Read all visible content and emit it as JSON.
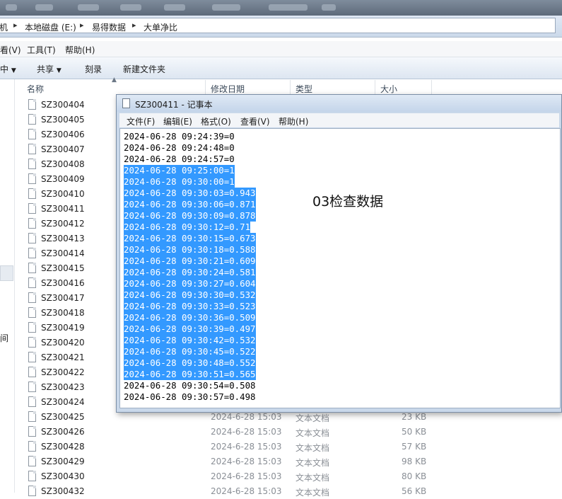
{
  "explorer": {
    "breadcrumb": [
      "机",
      "本地磁盘 (E:)",
      "易得数据",
      "大单净比"
    ],
    "menu": [
      "看(V)",
      "工具(T)",
      "帮助(H)"
    ],
    "toolbar": [
      "中",
      "共享",
      "刻录",
      "新建文件夹"
    ],
    "columns": {
      "name": "名称",
      "date": "修改日期",
      "type": "类型",
      "size": "大小"
    },
    "left_pane_label": "间",
    "files": [
      {
        "name": "SZ300404",
        "date": "",
        "type": "",
        "size": ""
      },
      {
        "name": "SZ300405",
        "date": "",
        "type": "",
        "size": ""
      },
      {
        "name": "SZ300406",
        "date": "",
        "type": "",
        "size": ""
      },
      {
        "name": "SZ300407",
        "date": "",
        "type": "",
        "size": ""
      },
      {
        "name": "SZ300408",
        "date": "",
        "type": "",
        "size": ""
      },
      {
        "name": "SZ300409",
        "date": "",
        "type": "",
        "size": ""
      },
      {
        "name": "SZ300410",
        "date": "",
        "type": "",
        "size": ""
      },
      {
        "name": "SZ300411",
        "date": "",
        "type": "",
        "size": ""
      },
      {
        "name": "SZ300412",
        "date": "",
        "type": "",
        "size": ""
      },
      {
        "name": "SZ300413",
        "date": "",
        "type": "",
        "size": ""
      },
      {
        "name": "SZ300414",
        "date": "",
        "type": "",
        "size": ""
      },
      {
        "name": "SZ300415",
        "date": "",
        "type": "",
        "size": ""
      },
      {
        "name": "SZ300416",
        "date": "",
        "type": "",
        "size": ""
      },
      {
        "name": "SZ300417",
        "date": "",
        "type": "",
        "size": ""
      },
      {
        "name": "SZ300418",
        "date": "",
        "type": "",
        "size": ""
      },
      {
        "name": "SZ300419",
        "date": "",
        "type": "",
        "size": ""
      },
      {
        "name": "SZ300420",
        "date": "",
        "type": "",
        "size": ""
      },
      {
        "name": "SZ300421",
        "date": "",
        "type": "",
        "size": ""
      },
      {
        "name": "SZ300422",
        "date": "",
        "type": "",
        "size": ""
      },
      {
        "name": "SZ300423",
        "date": "",
        "type": "",
        "size": ""
      },
      {
        "name": "SZ300424",
        "date": "",
        "type": "",
        "size": ""
      },
      {
        "name": "SZ300425",
        "date": "2024-6-28 15:03",
        "type": "文本文档",
        "size": "23 KB"
      },
      {
        "name": "SZ300426",
        "date": "2024-6-28 15:03",
        "type": "文本文档",
        "size": "50 KB"
      },
      {
        "name": "SZ300428",
        "date": "2024-6-28 15:03",
        "type": "文本文档",
        "size": "57 KB"
      },
      {
        "name": "SZ300429",
        "date": "2024-6-28 15:03",
        "type": "文本文档",
        "size": "98 KB"
      },
      {
        "name": "SZ300430",
        "date": "2024-6-28 15:03",
        "type": "文本文档",
        "size": "80 KB"
      },
      {
        "name": "SZ300432",
        "date": "2024-6-28 15:03",
        "type": "文本文档",
        "size": "56 KB"
      }
    ]
  },
  "notepad": {
    "title": "SZ300411 - 记事本",
    "menu": [
      "文件(F)",
      "编辑(E)",
      "格式(O)",
      "查看(V)",
      "帮助(H)"
    ],
    "lines": [
      {
        "text": "2024-06-28 09:24:39=0",
        "selected": false
      },
      {
        "text": "2024-06-28 09:24:48=0",
        "selected": false
      },
      {
        "text": "2024-06-28 09:24:57=0",
        "selected": false
      },
      {
        "text": "2024-06-28 09:25:00=1",
        "selected": true
      },
      {
        "text": "2024-06-28 09:30:00=1",
        "selected": true
      },
      {
        "text": "2024-06-28 09:30:03=0.943",
        "selected": true
      },
      {
        "text": "2024-06-28 09:30:06=0.871",
        "selected": true
      },
      {
        "text": "2024-06-28 09:30:09=0.878",
        "selected": true
      },
      {
        "text": "2024-06-28 09:30:12=0.71",
        "selected": true
      },
      {
        "text": "2024-06-28 09:30:15=0.673",
        "selected": true
      },
      {
        "text": "2024-06-28 09:30:18=0.588",
        "selected": true
      },
      {
        "text": "2024-06-28 09:30:21=0.609",
        "selected": true
      },
      {
        "text": "2024-06-28 09:30:24=0.581",
        "selected": true
      },
      {
        "text": "2024-06-28 09:30:27=0.604",
        "selected": true
      },
      {
        "text": "2024-06-28 09:30:30=0.532",
        "selected": true
      },
      {
        "text": "2024-06-28 09:30:33=0.523",
        "selected": true
      },
      {
        "text": "2024-06-28 09:30:36=0.509",
        "selected": true
      },
      {
        "text": "2024-06-28 09:30:39=0.497",
        "selected": true
      },
      {
        "text": "2024-06-28 09:30:42=0.532",
        "selected": true
      },
      {
        "text": "2024-06-28 09:30:45=0.522",
        "selected": true
      },
      {
        "text": "2024-06-28 09:30:48=0.552",
        "selected": true
      },
      {
        "text": "2024-06-28 09:30:51=0.565",
        "selected": true
      },
      {
        "text": "2024-06-28 09:30:54=0.508",
        "selected": false
      },
      {
        "text": "2024-06-28 09:30:57=0.498",
        "selected": false
      }
    ]
  },
  "annotation": "03检查数据",
  "colors": {
    "selection": "#3399ff",
    "window_frame": "#c9d8ea"
  }
}
